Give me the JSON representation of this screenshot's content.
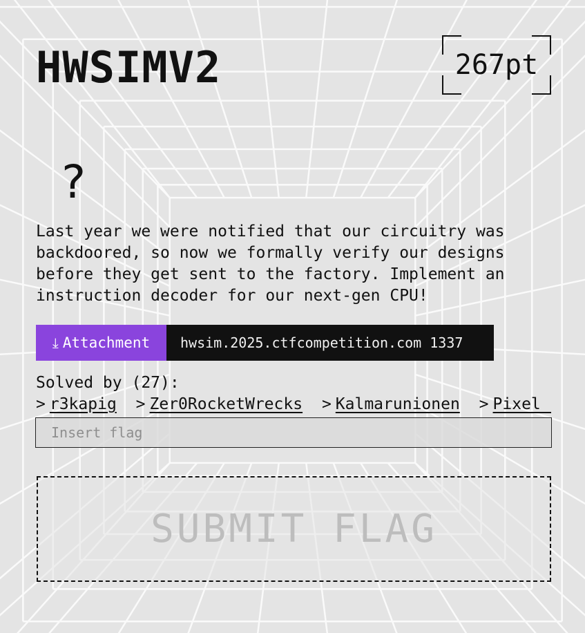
{
  "challenge": {
    "title": "HWSIMV2",
    "points": "267pt",
    "category_icon": "?",
    "description": "Last year we were notified that our circuitry was backdoored, so now we formally verify our designs before they get sent to the factory. Implement an instruction decoder for our next-gen CPU!",
    "attachment_label": "Attachment",
    "attachment_icon": "⤓",
    "connection": "hwsim.2025.ctfcompetition.com 1337"
  },
  "solves": {
    "label": "Solved by (27):",
    "chevron": ">",
    "teams": [
      "r3kapig",
      "Zer0RocketWrecks",
      "Kalmarunionen",
      "Pixel Pe"
    ]
  },
  "flag_form": {
    "placeholder": "Insert flag",
    "value": "",
    "submit_label": "SUBMIT FLAG"
  },
  "colors": {
    "background": "#e4e4e4",
    "grid_line": "#ffffff",
    "accent": "#8a44dd",
    "dark": "#111111",
    "muted": "#bdbdbd"
  }
}
